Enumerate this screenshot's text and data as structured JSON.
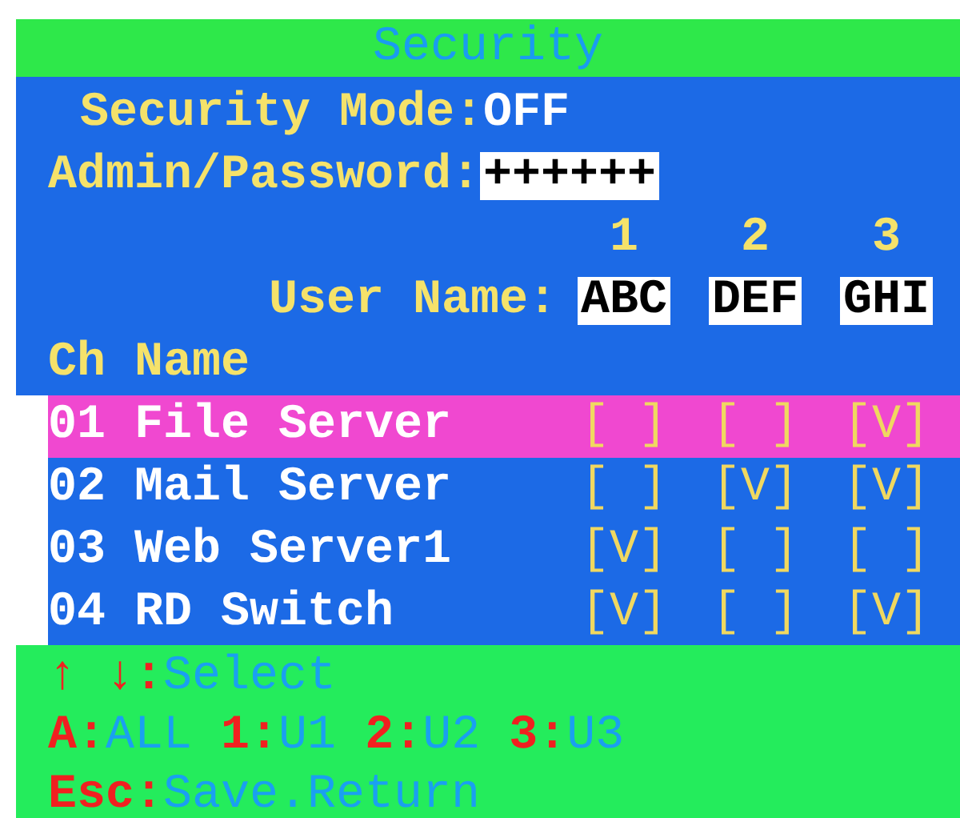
{
  "title": "Security",
  "settings": [
    {
      "label": "Security Mode:",
      "value": "OFF",
      "kind": "plain"
    },
    {
      "label": "Admin/Password:",
      "value": "++++++",
      "kind": "field"
    }
  ],
  "users": {
    "label": "User Name:",
    "columns": [
      {
        "number": "1",
        "name": "ABC"
      },
      {
        "number": "2",
        "name": "DEF"
      },
      {
        "number": "3",
        "name": "GHI"
      }
    ]
  },
  "list_header": "Ch Name",
  "channels": [
    {
      "name": "01 File Server",
      "selected": true,
      "access": [
        "[ ]",
        "[ ]",
        "[V]"
      ]
    },
    {
      "name": "02 Mail Server",
      "selected": false,
      "access": [
        "[ ]",
        "[V]",
        "[V]"
      ]
    },
    {
      "name": "03 Web Server1",
      "selected": false,
      "access": [
        "[V]",
        "[ ]",
        "[ ]"
      ]
    },
    {
      "name": "04 RD Switch",
      "selected": false,
      "access": [
        "[V]",
        "[ ]",
        "[V]"
      ]
    }
  ],
  "hints": [
    [
      {
        "key": "↑ ↓:",
        "action": "Select"
      }
    ],
    [
      {
        "key": "A:",
        "action": "ALL"
      },
      {
        "key": "1:",
        "action": "U1"
      },
      {
        "key": "2:",
        "action": "U2"
      },
      {
        "key": "3:",
        "action": "U3"
      }
    ],
    [
      {
        "key": "Esc:",
        "action": "Save.Return"
      }
    ]
  ]
}
